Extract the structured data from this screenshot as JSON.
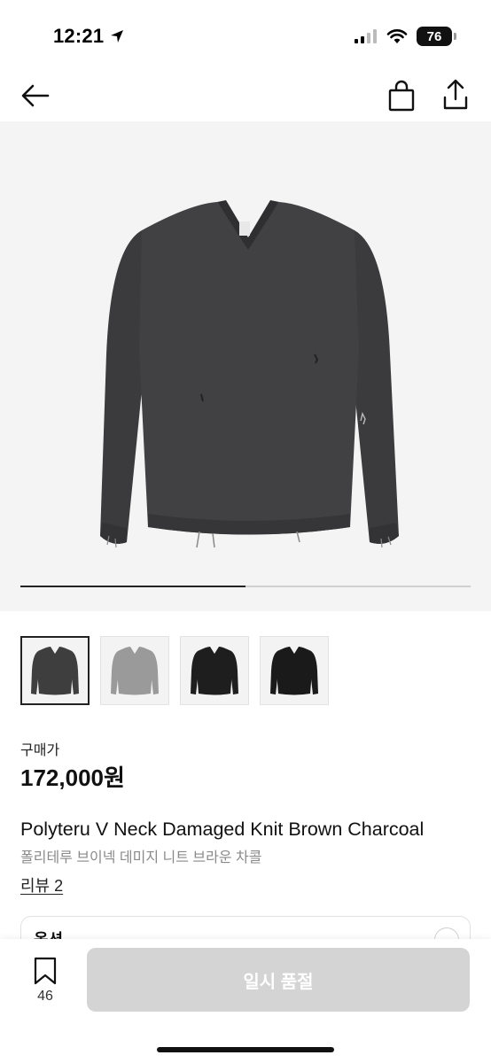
{
  "status_bar": {
    "time": "12:21",
    "battery": "76",
    "icons": [
      "location-arrow-icon",
      "cellular-signal-icon",
      "wifi-icon",
      "battery-icon"
    ]
  },
  "nav": {
    "icons": [
      "back-arrow-icon",
      "shopping-bag-icon",
      "share-icon"
    ]
  },
  "gallery": {
    "progress_percent": 50,
    "thumbnails": [
      {
        "name": "dark-charcoal-sweater",
        "color": "#3e3e3e"
      },
      {
        "name": "grey-distressed-sweater",
        "color": "#9a9a9a"
      },
      {
        "name": "black-sweater",
        "color": "#1e1e1e"
      },
      {
        "name": "black-sweater-alt",
        "color": "#1a1a1a"
      }
    ],
    "selected_index": 0
  },
  "product": {
    "price_label": "구매가",
    "price": "172,000원",
    "title_en": "Polyteru V Neck Damaged Knit Brown Charcoal",
    "title_ko": "폴리테루 브이넥 데미지 니트 브라운 차콜",
    "review_link": "리뷰 2"
  },
  "option": {
    "label": "옵션"
  },
  "bottom": {
    "wish_count": "46",
    "action_label": "일시 품절"
  },
  "colors": {
    "sweater": "#3e3e3e",
    "disabled_button": "#d4d4d4",
    "hero_bg": "#f4f4f4"
  }
}
